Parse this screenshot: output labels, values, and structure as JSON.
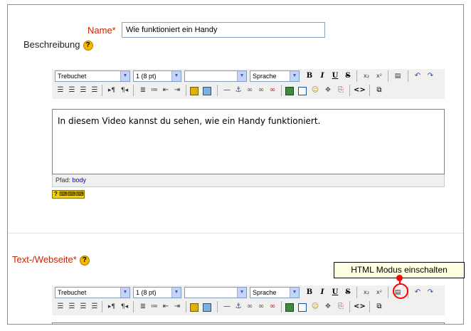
{
  "name_field": {
    "label": "Name*",
    "value": "Wie funktioniert ein Handy"
  },
  "description": {
    "label": "Beschreibung",
    "help": "?"
  },
  "text_webpage": {
    "label": "Text-/Webseite*",
    "help": "?"
  },
  "toolbar": {
    "font_family": "Trebuchet",
    "font_size": "1 (8 pt)",
    "style": "",
    "language": "Sprache",
    "bold": "B",
    "italic": "I",
    "underline": "U",
    "strike": "S",
    "subscript": "x₂",
    "superscript": "x²",
    "html_mode": "<>"
  },
  "editor1": {
    "content": "In diesem Video kannst du sehen, wie ein Handy funktioniert.",
    "path_label": "Pfad:",
    "path_value": "body"
  },
  "tooltip": {
    "text": "HTML Modus einschalten"
  },
  "colors": {
    "required_label": "#cc2200",
    "highlight": "#ff0000",
    "toolbar_bg": "#f0f0ee"
  }
}
